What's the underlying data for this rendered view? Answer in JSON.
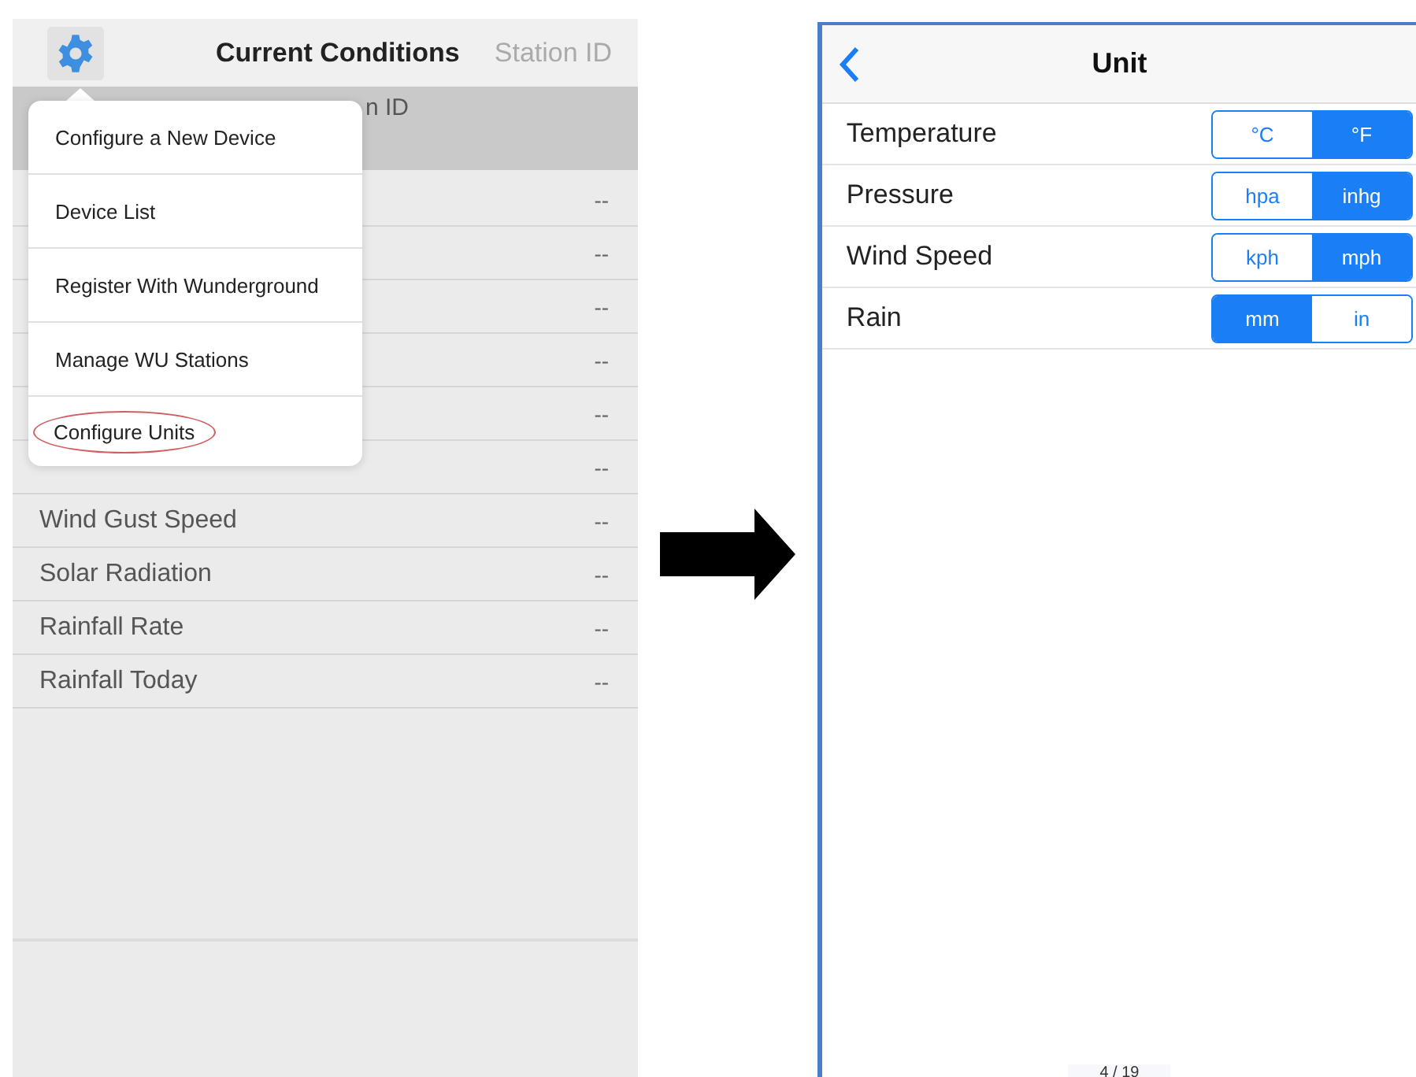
{
  "left_screen": {
    "title": "Current Conditions",
    "nav_right": "Station ID",
    "header_fragment": "n ID",
    "menu": {
      "items": [
        {
          "label": "Configure a New Device",
          "circled": false
        },
        {
          "label": "Device List",
          "circled": false
        },
        {
          "label": "Register With Wunderground",
          "circled": false
        },
        {
          "label": "Manage WU Stations",
          "circled": false
        },
        {
          "label": "Configure Units",
          "circled": true
        }
      ]
    },
    "rows": [
      {
        "value": "--"
      },
      {
        "value": "--"
      },
      {
        "value": "--"
      },
      {
        "value": "--"
      },
      {
        "value": "--"
      },
      {
        "value": "--"
      },
      {
        "label": "Wind Gust Speed",
        "value": "--"
      },
      {
        "label": "Solar Radiation",
        "value": "--"
      },
      {
        "label": "Rainfall Rate",
        "value": "--"
      },
      {
        "label": "Rainfall Today",
        "value": "--"
      }
    ]
  },
  "right_screen": {
    "title": "Unit",
    "settings": [
      {
        "label": "Temperature",
        "options": [
          {
            "label": "°C",
            "selected": false
          },
          {
            "label": "°F",
            "selected": true
          }
        ]
      },
      {
        "label": "Pressure",
        "options": [
          {
            "label": "hpa",
            "selected": false
          },
          {
            "label": "inhg",
            "selected": true
          }
        ]
      },
      {
        "label": "Wind Speed",
        "options": [
          {
            "label": "kph",
            "selected": false
          },
          {
            "label": "mph",
            "selected": true
          }
        ]
      },
      {
        "label": "Rain",
        "options": [
          {
            "label": "mm",
            "selected": true
          },
          {
            "label": "in",
            "selected": false
          }
        ]
      }
    ],
    "page_indicator": "4 / 19"
  }
}
